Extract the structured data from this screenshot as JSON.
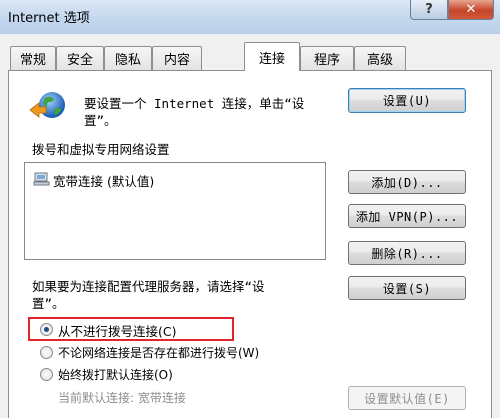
{
  "window": {
    "title": "Internet 选项",
    "help_label": "?",
    "close_label": "✕"
  },
  "tabs": [
    {
      "label": "常规"
    },
    {
      "label": "安全"
    },
    {
      "label": "隐私"
    },
    {
      "label": "内容"
    },
    {
      "label": "连接",
      "active": true
    },
    {
      "label": "程序"
    },
    {
      "label": "高级"
    }
  ],
  "setup": {
    "text_line1": "要设置一个 Internet 连接，单击“设",
    "text_line2": "置”。",
    "button": "设置(U)"
  },
  "dialup": {
    "heading": "拨号和虚拟专用网络设置",
    "items": [
      {
        "label": "宽带连接 (默认值)"
      }
    ],
    "add_button": "添加(D)...",
    "add_vpn_button": "添加 VPN(P)...",
    "delete_button": "删除(R)...",
    "proxy_text_line1": "如果要为连接配置代理服务器，请选择“设",
    "proxy_text_line2": "置”。",
    "settings_button": "设置(S)"
  },
  "options": [
    {
      "label": "从不进行拨号连接(C)",
      "checked": true
    },
    {
      "label": "不论网络连接是否存在都进行拨号(W)",
      "checked": false
    },
    {
      "label": "始终拨打默认连接(O)",
      "checked": false
    }
  ],
  "current_default": {
    "label": "当前默认连接: 宽带连接",
    "set_default_button": "设置默认值(E)"
  }
}
